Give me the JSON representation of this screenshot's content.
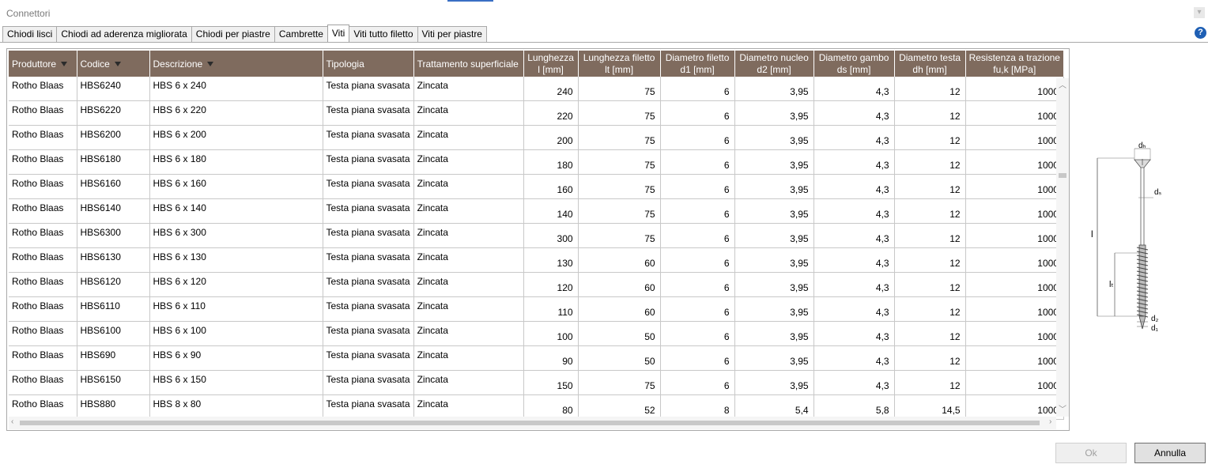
{
  "window": {
    "title": "Connettori"
  },
  "tabs": [
    {
      "label": "Chiodi lisci"
    },
    {
      "label": "Chiodi ad aderenza migliorata"
    },
    {
      "label": "Chiodi per piastre"
    },
    {
      "label": "Cambrette"
    },
    {
      "label": "Viti",
      "active": true
    },
    {
      "label": "Viti tutto filetto"
    },
    {
      "label": "Viti per piastre"
    }
  ],
  "help_label": "?",
  "columns": [
    {
      "l1": "Produttore",
      "filter": true
    },
    {
      "l1": "Codice",
      "filter": true
    },
    {
      "l1": "Descrizione",
      "filter": true
    },
    {
      "l1": "Tipologia"
    },
    {
      "l1": "Trattamento superficiale"
    },
    {
      "l1": "Lunghezza",
      "l2": "l [mm]"
    },
    {
      "l1": "Lunghezza filetto",
      "l2": "lt [mm]"
    },
    {
      "l1": "Diametro filetto",
      "l2": "d1 [mm]"
    },
    {
      "l1": "Diametro nucleo",
      "l2": "d2 [mm]"
    },
    {
      "l1": "Diametro gambo",
      "l2": "ds [mm]"
    },
    {
      "l1": "Diametro testa",
      "l2": "dh [mm]"
    },
    {
      "l1": "Resistenza a trazione",
      "l2": "fu,k [MPa]"
    }
  ],
  "rows": [
    [
      "Rotho Blaas",
      "HBS6240",
      "HBS 6 x 240",
      "Testa piana svasata",
      "Zincata",
      "240",
      "75",
      "6",
      "3,95",
      "4,3",
      "12",
      "1000"
    ],
    [
      "Rotho Blaas",
      "HBS6220",
      "HBS 6 x 220",
      "Testa piana svasata",
      "Zincata",
      "220",
      "75",
      "6",
      "3,95",
      "4,3",
      "12",
      "1000"
    ],
    [
      "Rotho Blaas",
      "HBS6200",
      "HBS 6 x 200",
      "Testa piana svasata",
      "Zincata",
      "200",
      "75",
      "6",
      "3,95",
      "4,3",
      "12",
      "1000"
    ],
    [
      "Rotho Blaas",
      "HBS6180",
      "HBS 6 x 180",
      "Testa piana svasata",
      "Zincata",
      "180",
      "75",
      "6",
      "3,95",
      "4,3",
      "12",
      "1000"
    ],
    [
      "Rotho Blaas",
      "HBS6160",
      "HBS 6 x 160",
      "Testa piana svasata",
      "Zincata",
      "160",
      "75",
      "6",
      "3,95",
      "4,3",
      "12",
      "1000"
    ],
    [
      "Rotho Blaas",
      "HBS6140",
      "HBS 6 x 140",
      "Testa piana svasata",
      "Zincata",
      "140",
      "75",
      "6",
      "3,95",
      "4,3",
      "12",
      "1000"
    ],
    [
      "Rotho Blaas",
      "HBS6300",
      "HBS 6 x 300",
      "Testa piana svasata",
      "Zincata",
      "300",
      "75",
      "6",
      "3,95",
      "4,3",
      "12",
      "1000"
    ],
    [
      "Rotho Blaas",
      "HBS6130",
      "HBS 6 x 130",
      "Testa piana svasata",
      "Zincata",
      "130",
      "60",
      "6",
      "3,95",
      "4,3",
      "12",
      "1000"
    ],
    [
      "Rotho Blaas",
      "HBS6120",
      "HBS 6 x 120",
      "Testa piana svasata",
      "Zincata",
      "120",
      "60",
      "6",
      "3,95",
      "4,3",
      "12",
      "1000"
    ],
    [
      "Rotho Blaas",
      "HBS6110",
      "HBS 6 x 110",
      "Testa piana svasata",
      "Zincata",
      "110",
      "60",
      "6",
      "3,95",
      "4,3",
      "12",
      "1000"
    ],
    [
      "Rotho Blaas",
      "HBS6100",
      "HBS 6 x 100",
      "Testa piana svasata",
      "Zincata",
      "100",
      "50",
      "6",
      "3,95",
      "4,3",
      "12",
      "1000"
    ],
    [
      "Rotho Blaas",
      "HBS690",
      "HBS 6 x 90",
      "Testa piana svasata",
      "Zincata",
      "90",
      "50",
      "6",
      "3,95",
      "4,3",
      "12",
      "1000"
    ],
    [
      "Rotho Blaas",
      "HBS6150",
      "HBS 6 x 150",
      "Testa piana svasata",
      "Zincata",
      "150",
      "75",
      "6",
      "3,95",
      "4,3",
      "12",
      "1000"
    ],
    [
      "Rotho Blaas",
      "HBS880",
      "HBS 8 x 80",
      "Testa piana svasata",
      "Zincata",
      "80",
      "52",
      "8",
      "5,4",
      "5,8",
      "14,5",
      "1000"
    ]
  ],
  "diagram_labels": {
    "dh": "dₕ",
    "ds": "dₛ",
    "l": "l",
    "lt": "lₜ",
    "d2": "d₂",
    "d1": "d₁"
  },
  "buttons": {
    "ok": "Ok",
    "cancel": "Annulla"
  }
}
